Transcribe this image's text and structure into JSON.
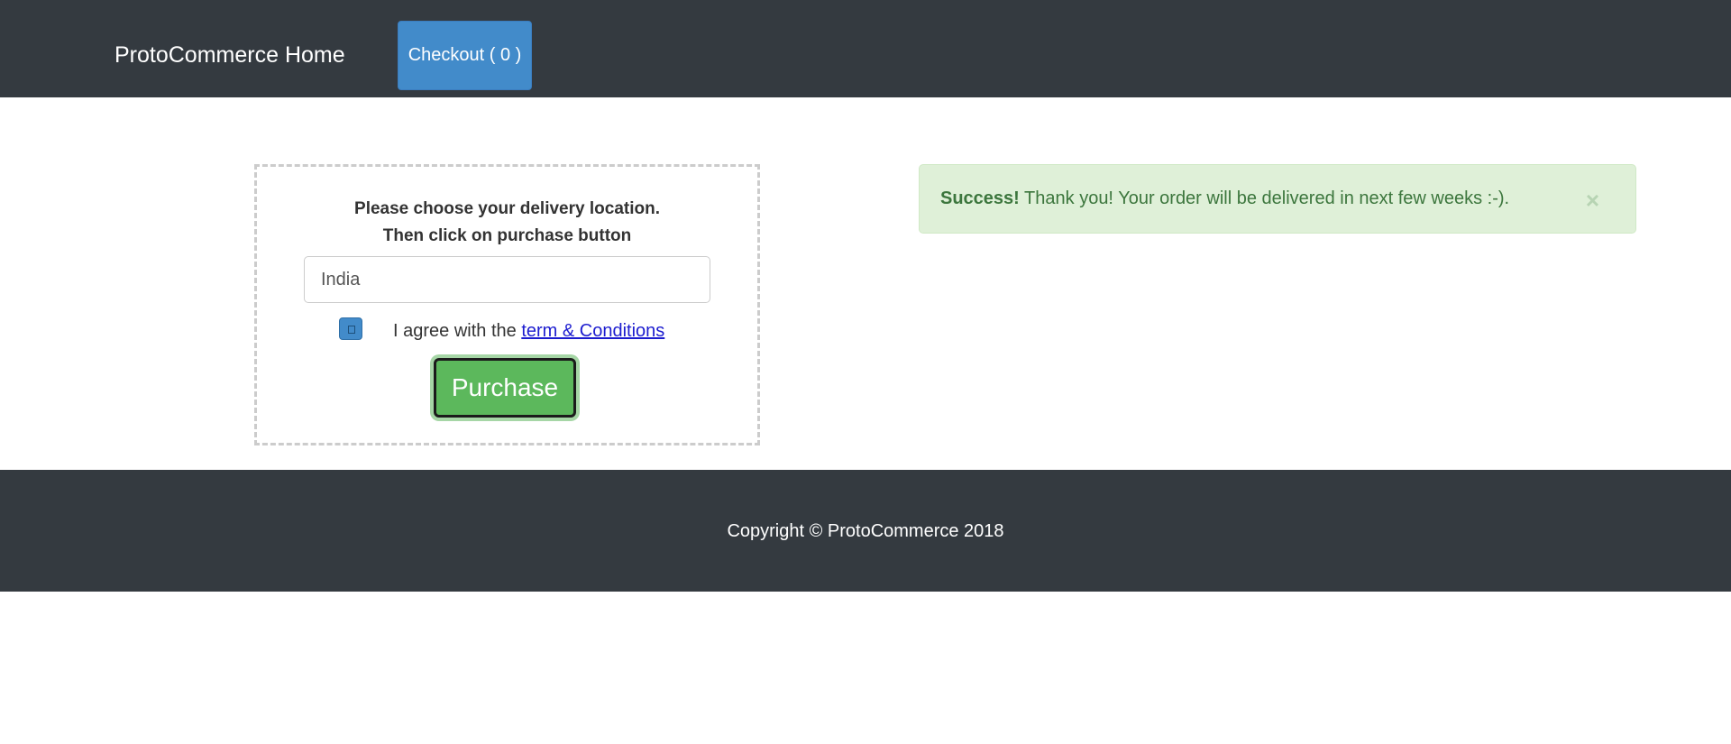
{
  "navbar": {
    "brand": "ProtoCommerce Home",
    "checkout_label": "Checkout ( 0 )"
  },
  "purchase_form": {
    "instruction_line1": "Please choose your delivery location.",
    "instruction_line2": "Then click on purchase button",
    "country_value": "India",
    "agree_text": "I agree with the",
    "terms_link": "term & Conditions",
    "checkbox_checked": true,
    "purchase_label": "Purchase"
  },
  "alert": {
    "strong": "Success!",
    "message": "Thank you! Your order will be delivered in next few weeks :-).",
    "close_symbol": "×",
    "color": "#3c763d",
    "background": "#dff0d8"
  },
  "footer": {
    "copyright": "Copyright © ProtoCommerce 2018"
  },
  "colors": {
    "navbar_bg": "#343a40",
    "checkout_bg": "#428bca",
    "purchase_bg": "#5cb85c"
  }
}
